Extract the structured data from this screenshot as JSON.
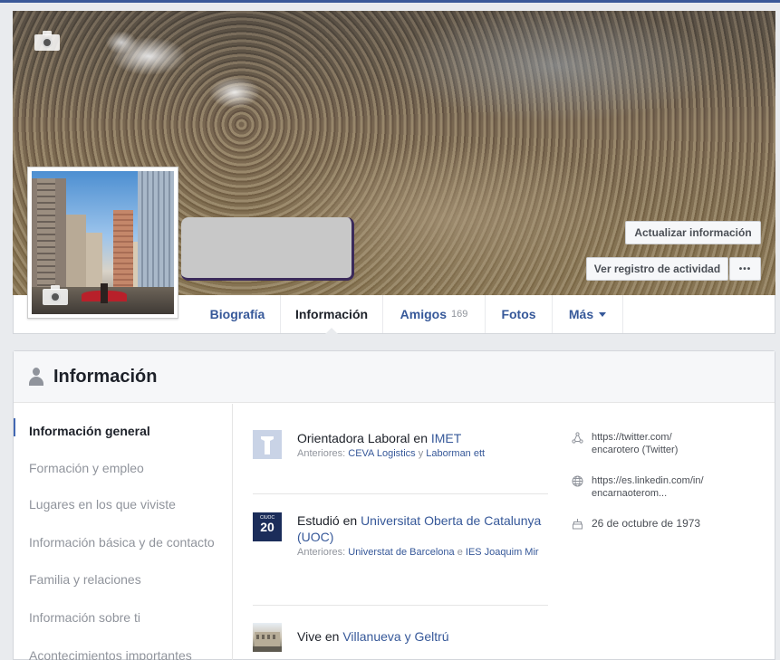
{
  "cover": {
    "update_info_label": "Actualizar información",
    "activity_log_label": "Ver registro de actividad",
    "more_label": "•••"
  },
  "nav": {
    "tabs": [
      {
        "label": "Biografía"
      },
      {
        "label": "Información"
      },
      {
        "label": "Amigos",
        "count": "169"
      },
      {
        "label": "Fotos"
      },
      {
        "label": "Más"
      }
    ]
  },
  "about": {
    "title": "Información",
    "sections": [
      "Información general",
      "Formación y empleo",
      "Lugares en los que viviste",
      "Información básica y de contacto",
      "Familia y relaciones",
      "Información sobre ti",
      "Acontecimientos importantes"
    ],
    "work": {
      "prefix": "Orientadora Laboral en ",
      "employer": "IMET",
      "previous_prefix": "Anteriores: ",
      "previous_1": "CEVA Logistics",
      "previous_sep": " y ",
      "previous_2": "Laborman ett"
    },
    "education": {
      "prefix": "Estudió en ",
      "school": "Universitat Oberta de Catalunya (UOC)",
      "thumb_top": "CIUOC",
      "thumb_num": "20",
      "previous_prefix": "Anteriores: ",
      "previous_1": "Universtat de Barcelona",
      "previous_sep": " e ",
      "previous_2": "IES Joaquim Mir"
    },
    "lives": {
      "prefix": "Vive en ",
      "place": "Villanueva y Geltrú"
    },
    "contact": {
      "twitter_url": "https://twitter.com/",
      "twitter_handle": "encarotero",
      "twitter_suffix": " (Twitter)",
      "linkedin_url": "https://es.linkedin.com/in/",
      "linkedin_handle": "encarnaoterom...",
      "birthday": "26 de octubre de 1973"
    }
  }
}
